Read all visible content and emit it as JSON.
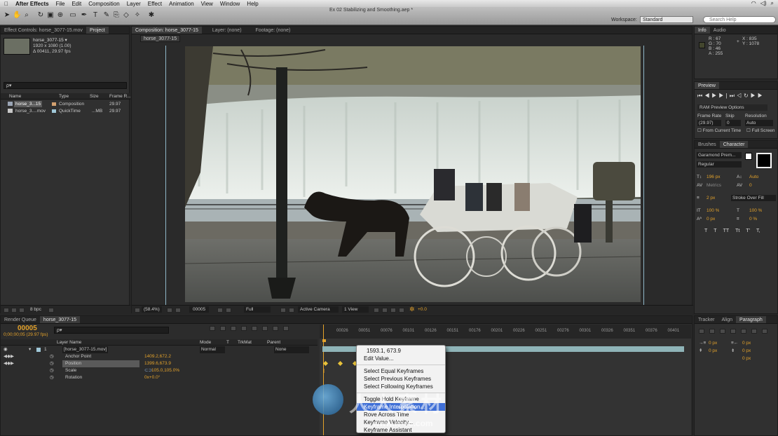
{
  "menubar": {
    "apple": "",
    "app": "After Effects",
    "items": [
      "File",
      "Edit",
      "Composition",
      "Layer",
      "Effect",
      "Animation",
      "View",
      "Window",
      "Help"
    ],
    "status": "Search Help"
  },
  "window": {
    "title": "Ex 02 Stabilizing and Smoothing.aep *",
    "workspace_label": "Workspace:",
    "workspace_value": "Standard",
    "search_placeholder": "Search Help"
  },
  "project": {
    "tabs": [
      "Effect Controls: horse_3077-15.mov",
      "Project"
    ],
    "item_name": "horse_3077-15 ▾",
    "item_res": "1920 x 1080 (1.00)",
    "item_dur": "Δ 00411, 29.97 fps",
    "search_placeholder": "ρ▾",
    "columns": [
      "Name",
      "Type",
      "Size",
      "Frame R..."
    ],
    "rows": [
      {
        "name": "horse_3...15",
        "type": "Composition",
        "size": "",
        "fps": "29.97"
      },
      {
        "name": "horse_3....mov",
        "type": "QuickTime",
        "size": "...MB",
        "fps": "29.97"
      }
    ],
    "bpc": "8 bpc"
  },
  "composition": {
    "tabs": [
      "Composition: horse_3077-15",
      "Layer: (none)",
      "Footage: (none)"
    ],
    "subtab": "horse_3077-15",
    "zoom": "(58.4%)",
    "timecode": "00005",
    "resolution": "Full",
    "camera": "Active Camera",
    "views": "1 View",
    "exposure": "+0.0"
  },
  "info": {
    "tabs": [
      "Info",
      "Audio"
    ],
    "r": "R : 67",
    "g": "G : 70",
    "b": "B : 46",
    "a": "A : 255",
    "x": "X : 835",
    "y": "Y : 1078"
  },
  "preview": {
    "tab": "Preview",
    "ram": "RAM Preview Options",
    "frame_rate_label": "Frame Rate",
    "skip_label": "Skip",
    "resolution_label": "Resolution",
    "frame_rate": "(29.97)",
    "skip": "0",
    "resolution": "Auto",
    "from_current": "From Current Time",
    "full_screen": "Full Screen"
  },
  "character": {
    "tabs": [
      "Brushes",
      "Character"
    ],
    "font": "Garamond Prem...",
    "style": "Regular",
    "size": "196 px",
    "leading": "Auto",
    "kerning": "Metrics",
    "tracking": "0",
    "stroke": "2 px",
    "stroke_type": "Stroke Over Fill",
    "vscale": "100 %",
    "hscale": "100 %",
    "baseline": "0 px",
    "tsume": "0 %",
    "buttons": [
      "T",
      "T",
      "TT",
      "Tt",
      "T'",
      "T,"
    ]
  },
  "paragraph": {
    "tabs": [
      "Tracker",
      "Align",
      "Paragraph"
    ],
    "values": [
      "0 px",
      "0 px",
      "0 px",
      "0 px",
      "0 px"
    ]
  },
  "render": {
    "tabs": [
      "Render Queue",
      "horse_3077-15"
    ]
  },
  "timeline": {
    "timecode": "00005",
    "sub": "0;00;00;05 (29.97 fps)",
    "search": "ρ▾",
    "columns": [
      "Layer Name",
      "Mode",
      "T",
      "TrkMat",
      "Parent"
    ],
    "layers": [
      {
        "num": "1",
        "name": "[horse_3077-15.mov]",
        "mode": "Normal",
        "parent": "None"
      }
    ],
    "props": [
      {
        "name": "Anchor Point",
        "value": "1409.2,672.2"
      },
      {
        "name": "Position",
        "value": "1399.6,673.9"
      },
      {
        "name": "Scale",
        "value": "105.0,105.0%"
      },
      {
        "name": "Rotation",
        "value": "0x+0.0°"
      }
    ],
    "ruler": [
      "00026",
      "00051",
      "00076",
      "00101",
      "00126",
      "00151",
      "00176",
      "00201",
      "00226",
      "00251",
      "00276",
      "00301",
      "00326",
      "00351",
      "00376",
      "00401"
    ]
  },
  "context_menu": {
    "value": "1593.1, 673.9",
    "items": [
      "Edit Value...",
      "Select Equal Keyframes",
      "Select Previous Keyframes",
      "Select Following Keyframes",
      "Toggle Hold Keyframe",
      "Keyframe Interpolation...",
      "Rove Across Time",
      "Keyframe Velocity...",
      "Keyframe Assistant"
    ],
    "highlighted": 5
  },
  "watermark": {
    "text": "人人素材",
    "url": "www.rr-sc.com"
  }
}
